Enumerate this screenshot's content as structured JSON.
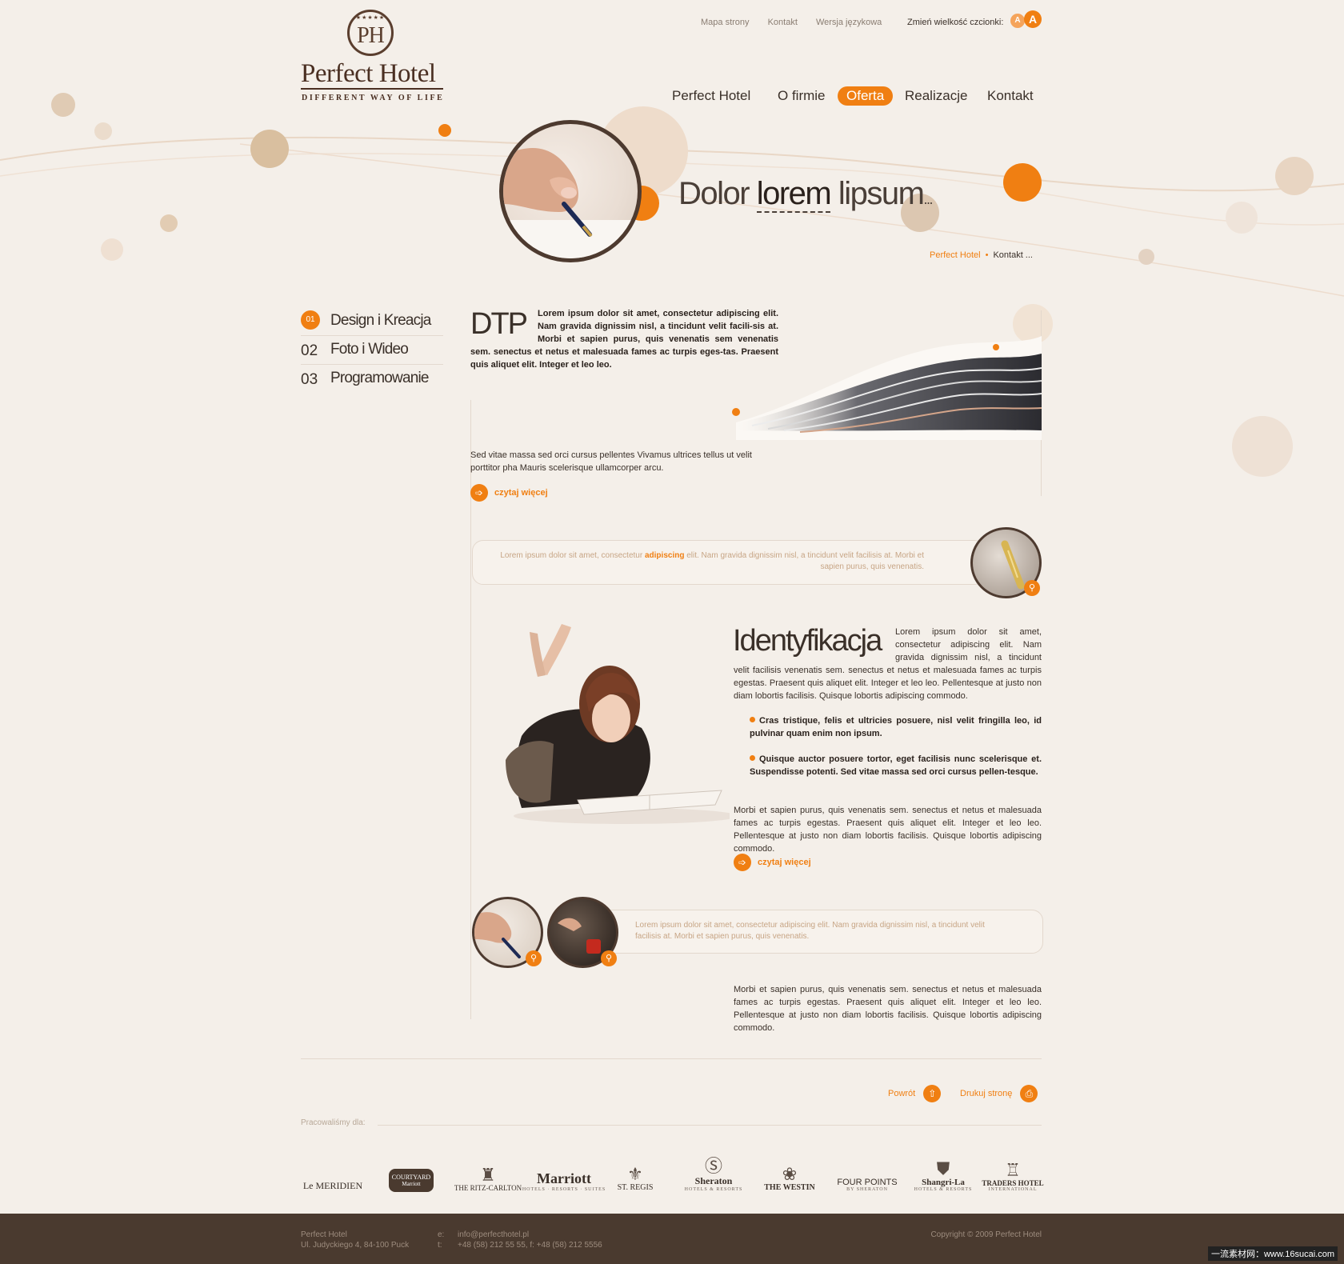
{
  "colors": {
    "accent": "#f07f12",
    "brown_dark": "#4a3a2f",
    "background": "#f4efe9",
    "quote_text": "#c7a585"
  },
  "top_links": [
    "Mapa strony",
    "Kontakt",
    "Wersja językowa"
  ],
  "font_size": {
    "label": "Zmień wielkość czcionki:",
    "small": "A",
    "large": "A"
  },
  "logo": {
    "mark": "PH",
    "stars": "★★★★★",
    "name": "Perfect Hotel",
    "tagline": "DIFFERENT WAY OF LIFE"
  },
  "nav": [
    "Perfect Hotel",
    "O firmie",
    "Oferta",
    "Realizacje",
    "Kontakt"
  ],
  "nav_active": "Oferta",
  "hero": {
    "title_1": "Dolor",
    "title_emph": "lorem",
    "title_2": "lipsum",
    "title_ellipsis": "..."
  },
  "breadcrumb": {
    "home": "Perfect Hotel",
    "current": "Kontakt ..."
  },
  "sidenav": [
    {
      "num": "01",
      "label": "Design i Kreacja",
      "active": true
    },
    {
      "num": "02",
      "label": "Foto i Wideo",
      "active": false
    },
    {
      "num": "03",
      "label": "Programowanie",
      "active": false
    }
  ],
  "dtp": {
    "title": "DTP",
    "lead": "Lorem ipsum dolor sit amet, consectetur adipiscing elit. Nam gravida dignissim nisl, a tincidunt velit facili-sis at. Morbi et sapien purus, quis venenatis sem venenatis sem. senectus et netus et malesuada fames ac turpis eges-tas. Praesent quis aliquet elit. Integer et leo leo.",
    "text": "Sed vitae massa sed orci cursus pellentes Vivamus ultrices tellus ut velit porttitor pha Mauris scelerisque ullamcorper arcu.",
    "more": "czytaj więcej"
  },
  "quote1": {
    "before": "Lorem ipsum dolor sit amet, consectetur ",
    "bold": "adipiscing",
    "after": " elit. Nam gravida dignissim nisl, a tincidunt velit facilisis at. Morbi et sapien purus, quis venenatis."
  },
  "identyfikacja": {
    "title": "Identyfikacja",
    "lead": "Lorem ipsum dolor sit amet, consectetur adipiscing elit. Nam gravida dignissim nisl, a tincidunt velit facilisis venenatis sem. senectus et netus et malesuada fames ac turpis egestas. Praesent quis aliquet elit. Integer et leo leo. Pellentesque at justo non diam lobortis facilisis. Quisque lobortis adipiscing commodo.",
    "bullets": [
      "Cras tristique, felis et ultricies posuere, nisl velit fringilla leo, id pulvinar quam enim non ipsum.",
      "Quisque auctor posuere tortor, eget facilisis nunc scelerisque et. Suspendisse potenti. Sed vitae massa sed orci cursus pellen-tesque."
    ],
    "text": "Morbi et sapien purus, quis venenatis sem. senectus et netus et malesuada fames ac turpis egestas. Praesent quis aliquet elit. Integer et leo leo. Pellentesque at justo non diam lobortis facilisis. Quisque lobortis adipiscing commodo.",
    "more": "czytaj więcej"
  },
  "quote2": {
    "text": "Lorem ipsum dolor sit amet, consectetur adipiscing elit. Nam gravida dignissim nisl, a tincidunt velit facilisis at. Morbi et sapien purus, quis venenatis."
  },
  "bottom_text": "Morbi et sapien purus, quis venenatis sem. senectus et netus et malesuada fames ac turpis egestas. Praesent quis aliquet elit. Integer et leo leo. Pellentesque at justo non diam lobortis facilisis. Quisque lobortis adipiscing commodo.",
  "actions": {
    "back": "Powrót",
    "print": "Drukuj stronę"
  },
  "worked_for": "Pracowaliśmy dla:",
  "partners": [
    {
      "name": "Le MERIDIEN",
      "sub": ""
    },
    {
      "name": "COURTYARD",
      "sub": "Marriott"
    },
    {
      "name": "THE RITZ-CARLTON",
      "sub": ""
    },
    {
      "name": "Marriott",
      "sub": "HOTELS · RESORTS · SUITES"
    },
    {
      "name": "ST. REGIS",
      "sub": ""
    },
    {
      "name": "Sheraton",
      "sub": "HOTELS & RESORTS"
    },
    {
      "name": "THE WESTIN",
      "sub": ""
    },
    {
      "name": "FOUR POINTS",
      "sub": "BY SHERATON"
    },
    {
      "name": "Shangri-La",
      "sub": "HOTELS & RESORTS"
    },
    {
      "name": "TRADERS HOTEL",
      "sub": "INTERNATIONAL"
    }
  ],
  "footer": {
    "company": "Perfect Hotel",
    "address": "Ul. Judyckiego 4, 84-100 Puck",
    "e_label": "e:",
    "t_label": "t:",
    "email": "info@perfecthotel.pl",
    "phone": "+48 (58) 212 55 55, f: +48 (58) 212 5556",
    "copyright": "Copyright © 2009 Perfect Hotel"
  },
  "watermark": "一流素材网：www.16sucai.com"
}
